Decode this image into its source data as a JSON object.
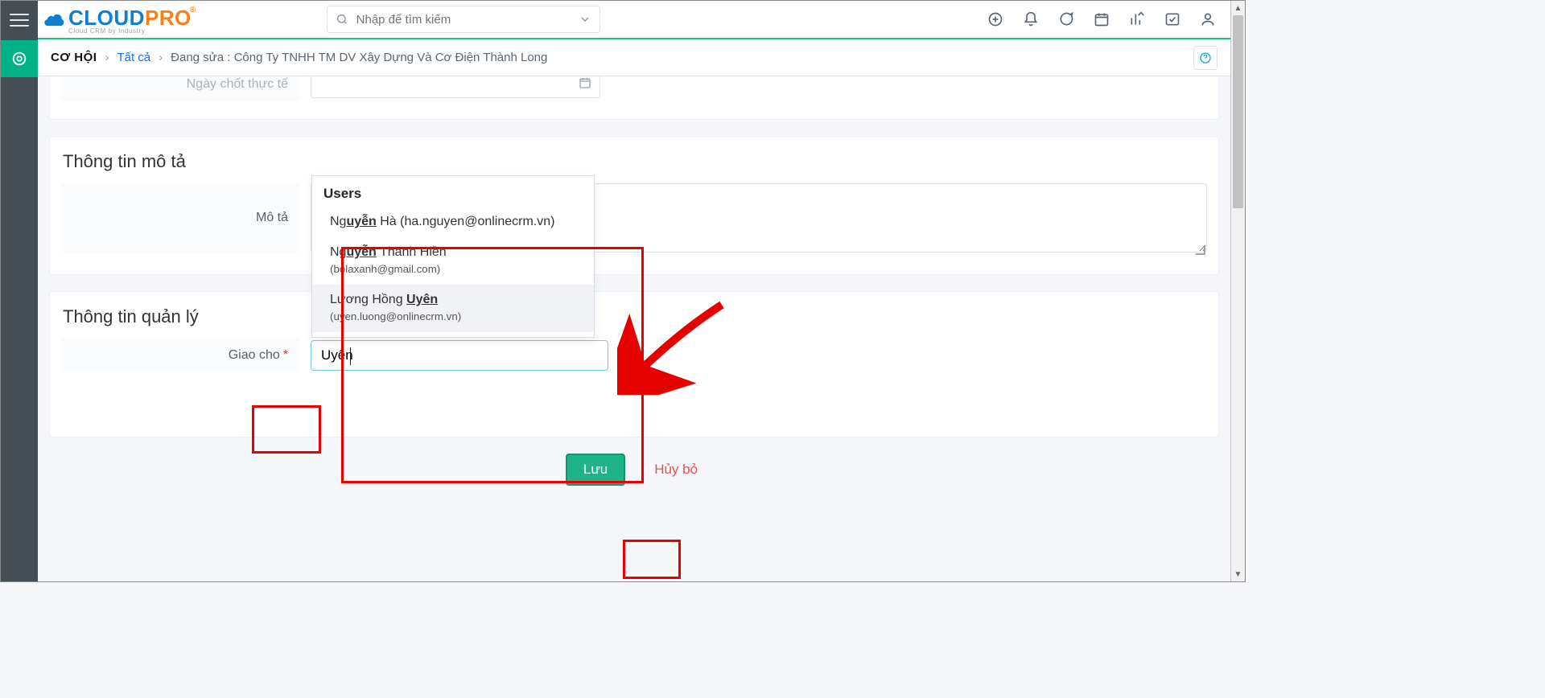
{
  "header": {
    "search_placeholder": "Nhập để tìm kiếm"
  },
  "breadcrumb": {
    "module": "CƠ HỘI",
    "all": "Tất cả",
    "editing_prefix": "Đang sửa :",
    "record": "Công Ty TNHH TM DV Xây Dựng Và Cơ Điện Thành Long"
  },
  "fields": {
    "close_date_label": "Ngày chốt thực tế",
    "desc_section": "Thông tin mô tả",
    "description_label": "Mô tả",
    "mgmt_section": "Thông tin quản lý",
    "assigned_to_label": "Giao cho",
    "assigned_to_value": "Uyên"
  },
  "dropdown": {
    "title": "Users",
    "items": [
      {
        "prefix": "Ng",
        "match": "uyễn",
        "rest": " Hà (ha.nguyen@onlinecrm.vn)",
        "hover": false
      },
      {
        "prefix": "Ng",
        "match": "uyễn",
        "rest": " Thanh Hiền",
        "line2": "(bolaxanh@gmail.com)",
        "hover": false
      },
      {
        "prefix": "Lương Hồng ",
        "match": "Uyên",
        "rest": "",
        "line2": "(uyen.luong@onlinecrm.vn)",
        "hover": true
      }
    ]
  },
  "buttons": {
    "save": "Lưu",
    "cancel": "Hủy bỏ"
  }
}
